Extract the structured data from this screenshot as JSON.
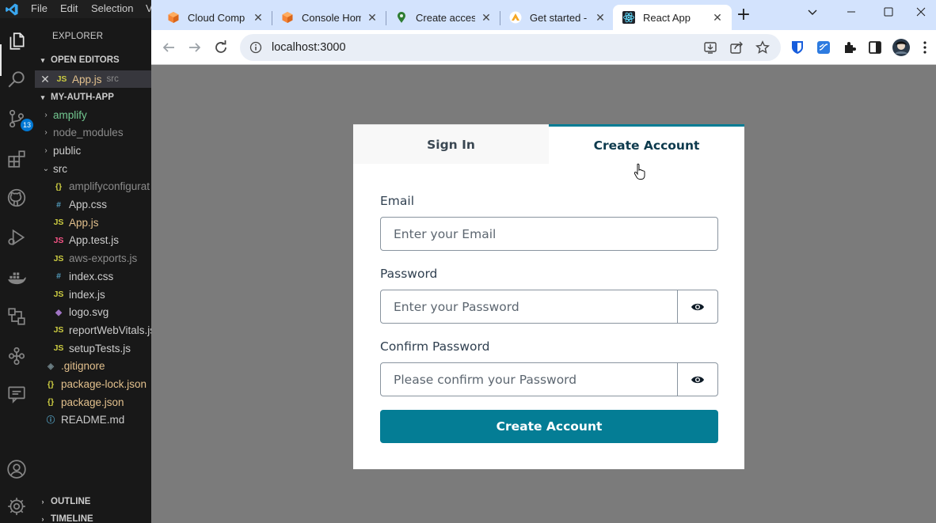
{
  "vscode": {
    "menu": [
      "File",
      "Edit",
      "Selection",
      "V"
    ],
    "scm_badge": "13",
    "explorer_title": "EXPLORER",
    "open_editors": {
      "title": "OPEN EDITORS",
      "items": [
        {
          "icon": "JS",
          "name": "App.js",
          "path": "src"
        }
      ]
    },
    "project": {
      "title": "MY-AUTH-APP",
      "tree": [
        {
          "kind": "folder",
          "name": "amplify",
          "color": "#73c991"
        },
        {
          "kind": "folder",
          "name": "node_modules",
          "color": "#8b8b8b"
        },
        {
          "kind": "folder",
          "name": "public",
          "color": "#cccccc"
        },
        {
          "kind": "folder-open",
          "name": "src",
          "color": "#cccccc"
        },
        {
          "kind": "file",
          "icon": "{}",
          "icon_color": "#cbcb41",
          "name": "amplifyconfigurat",
          "color": "#8b8b8b"
        },
        {
          "kind": "file",
          "icon": "#",
          "icon_color": "#519aba",
          "name": "App.css",
          "color": "#cccccc"
        },
        {
          "kind": "file",
          "icon": "JS",
          "icon_color": "#cbcb41",
          "name": "App.js",
          "color": "#e2c08d"
        },
        {
          "kind": "file",
          "icon": "JS",
          "icon_color": "#f55385",
          "name": "App.test.js",
          "color": "#cccccc"
        },
        {
          "kind": "file",
          "icon": "JS",
          "icon_color": "#cbcb41",
          "name": "aws-exports.js",
          "color": "#8b8b8b"
        },
        {
          "kind": "file",
          "icon": "#",
          "icon_color": "#519aba",
          "name": "index.css",
          "color": "#cccccc"
        },
        {
          "kind": "file",
          "icon": "JS",
          "icon_color": "#cbcb41",
          "name": "index.js",
          "color": "#cccccc"
        },
        {
          "kind": "file",
          "icon": "◆",
          "icon_color": "#a074c4",
          "name": "logo.svg",
          "color": "#cccccc"
        },
        {
          "kind": "file",
          "icon": "JS",
          "icon_color": "#cbcb41",
          "name": "reportWebVitals.js",
          "color": "#cccccc"
        },
        {
          "kind": "file",
          "icon": "JS",
          "icon_color": "#cbcb41",
          "name": "setupTests.js",
          "color": "#cccccc"
        },
        {
          "kind": "root-file",
          "icon": "◈",
          "icon_color": "#6d8086",
          "name": ".gitignore",
          "color": "#e2c08d"
        },
        {
          "kind": "root-file",
          "icon": "{}",
          "icon_color": "#cbcb41",
          "name": "package-lock.json",
          "color": "#e2c08d"
        },
        {
          "kind": "root-file",
          "icon": "{}",
          "icon_color": "#cbcb41",
          "name": "package.json",
          "color": "#e2c08d"
        },
        {
          "kind": "root-file",
          "icon": "ⓘ",
          "icon_color": "#519aba",
          "name": "README.md",
          "color": "#cccccc"
        }
      ]
    },
    "outline_title": "OUTLINE",
    "timeline_title": "TIMELINE"
  },
  "browser": {
    "tabs": [
      {
        "title": "Cloud Comp",
        "favicon": "aws-cube-icon",
        "active": false
      },
      {
        "title": "Console Hom",
        "favicon": "aws-cube-icon",
        "active": false
      },
      {
        "title": "Create access",
        "favicon": "pin-icon",
        "active": false
      },
      {
        "title": "Get started -",
        "favicon": "amplify-icon",
        "active": false
      },
      {
        "title": "React App",
        "favicon": "react-icon",
        "active": true
      }
    ],
    "url": "localhost:3000"
  },
  "auth": {
    "tab_signin": "Sign In",
    "tab_create": "Create Account",
    "email_label": "Email",
    "email_placeholder": "Enter your Email",
    "password_label": "Password",
    "password_placeholder": "Enter your Password",
    "confirm_label": "Confirm Password",
    "confirm_placeholder": "Please confirm your Password",
    "submit_label": "Create Account",
    "accent_color": "#047d95"
  }
}
